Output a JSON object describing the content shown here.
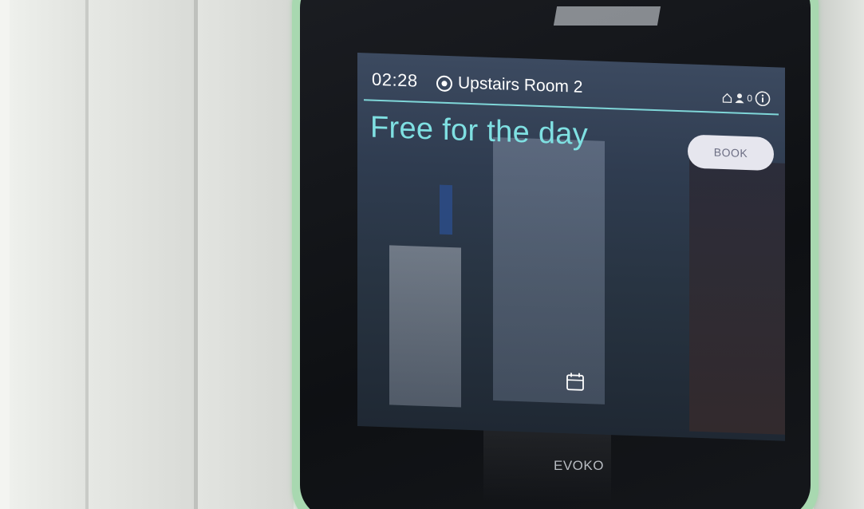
{
  "topbar": {
    "time": "02:28",
    "room_name": "Upstairs Room 2",
    "occupancy_count": "0"
  },
  "main": {
    "status_text": "Free for the day",
    "book_label": "BOOK"
  },
  "device": {
    "brand": "EVOKO"
  },
  "colors": {
    "accent": "#7fe0e2",
    "button_bg": "#e6e6ee",
    "bezel": "#a8d8b0"
  },
  "icons": {
    "location": "location-icon",
    "home": "home-icon",
    "person": "person-icon",
    "info": "info-icon",
    "calendar": "calendar-icon"
  }
}
